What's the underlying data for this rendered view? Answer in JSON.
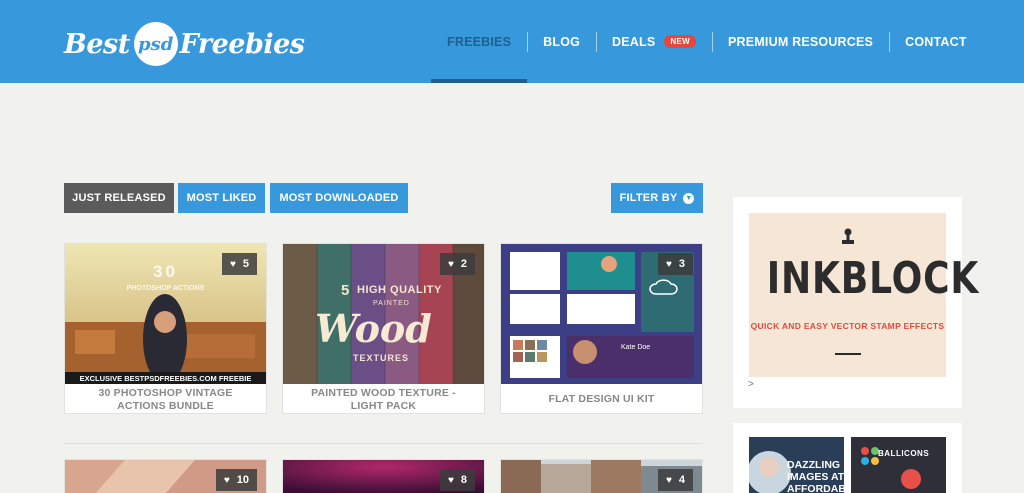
{
  "header": {
    "logo": {
      "part1": "Best",
      "part2": "psd",
      "part3": "Freebies"
    },
    "nav": [
      {
        "label": "FREEBIES",
        "active": true
      },
      {
        "label": "BLOG"
      },
      {
        "label": "DEALS",
        "badge": "NEW"
      },
      {
        "label": "PREMIUM RESOURCES"
      },
      {
        "label": "CONTACT"
      }
    ]
  },
  "tabs": {
    "just_released": "JUST RELEASED",
    "most_liked": "MOST LIKED",
    "most_downloaded": "MOST DOWNLOADED",
    "filter_by": "FILTER BY"
  },
  "cards": [
    {
      "title": "30 PHOTOSHOP VINTAGE ACTIONS BUNDLE",
      "likes": "5",
      "thumb": {
        "number": "30",
        "subtitle": "PHOTOSHOP ACTIONS",
        "banner": "EXCLUSIVE BESTPSDFREEBIES.COM FREEBIE"
      }
    },
    {
      "title": "PAINTED WOOD TEXTURE - LIGHT PACK",
      "likes": "2",
      "thumb": {
        "number": "5",
        "line1": "HIGH QUALITY",
        "line2": "PAINTED",
        "word": "Wood",
        "line3": "TEXTURES"
      }
    },
    {
      "title": "FLAT DESIGN UI KIT",
      "likes": "3",
      "thumb": {
        "name": "Kate Doe"
      }
    },
    {
      "likes": "10"
    },
    {
      "likes": "8"
    },
    {
      "likes": "4"
    }
  ],
  "sidebar": {
    "ad": {
      "title": "INKBLOCK",
      "subtitle": "QUICK AND EASY VECTOR STAMP EFFECTS",
      "caret": ">"
    },
    "ad2": {
      "left_text": "DAZZLING IMAGES AT AFFORDABLE",
      "right_text": "BALLICONS"
    }
  },
  "colors": {
    "header": "#3799dc",
    "active_nav": "#1f5f8f",
    "tab_active": "#5b5b5b",
    "badge_new": "#e5463d",
    "ad_accent": "#e24b3c"
  }
}
